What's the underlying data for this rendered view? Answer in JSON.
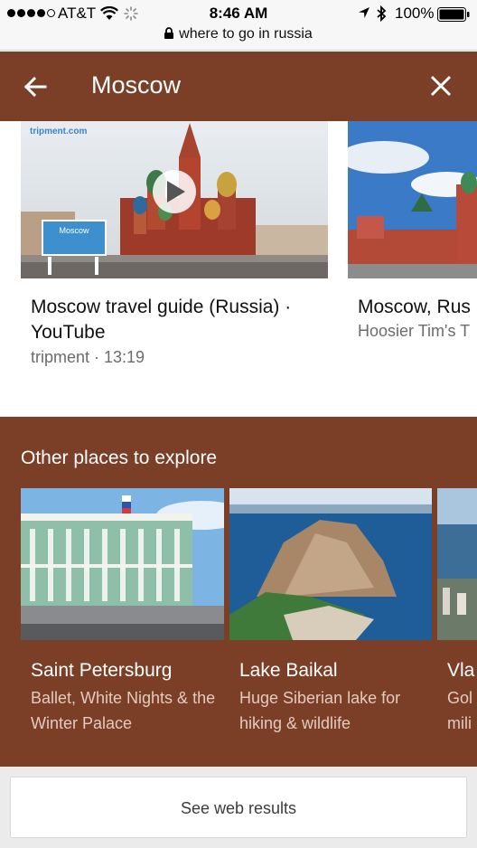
{
  "status_bar": {
    "carrier": "AT&T",
    "time": "8:46 AM",
    "battery": "100%",
    "url": "where to go in russia"
  },
  "header": {
    "query": "Moscow"
  },
  "videos": [
    {
      "title": "Moscow travel guide (Russia) · YouTube",
      "meta": "tripment · 13:19",
      "thumb_brand": "tripment.com",
      "thumb_sign": "Moscow"
    },
    {
      "title": "Moscow, Rus",
      "meta": "Hoosier Tim's T"
    }
  ],
  "explore": {
    "heading": "Other places to explore",
    "places": [
      {
        "name": "Saint Petersburg",
        "description": "Ballet, White Nights & the Winter Palace"
      },
      {
        "name": "Lake Baikal",
        "description": "Huge Siberian lake for hiking & wildlife"
      },
      {
        "name": "Vla",
        "description": "Gol mili"
      }
    ]
  },
  "web_results_label": "See web results",
  "colors": {
    "brand": "#7b3f27",
    "subtitle_on_brand": "#e3cbbf"
  }
}
